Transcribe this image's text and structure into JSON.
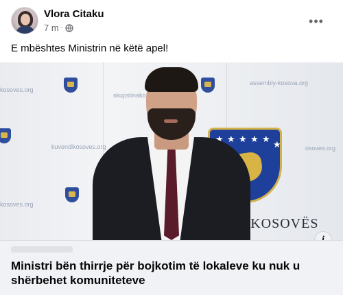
{
  "post": {
    "author": "Vlora Citaku",
    "time": "7 m",
    "separator": "·",
    "privacy_icon": "globe-icon",
    "more_label": "•••",
    "text": "E mbështes Ministrin në këtë apel!"
  },
  "image": {
    "watermarks": {
      "kosoves_org_1": "kosoves.org",
      "skupstina": "skupstinako",
      "assembly": "assembly-kosova.org",
      "kuvendi": "kuvendikosoves.org",
      "kosoves_org_2": "kosoves.org",
      "kosoves_org_3": "osoves.org"
    },
    "banner_text": "E KOSOVËS",
    "info_icon": "i"
  },
  "link": {
    "title": "Ministri bën thirrje për bojkotim të lokaleve ku nuk u shërbehet komuniteteve"
  }
}
